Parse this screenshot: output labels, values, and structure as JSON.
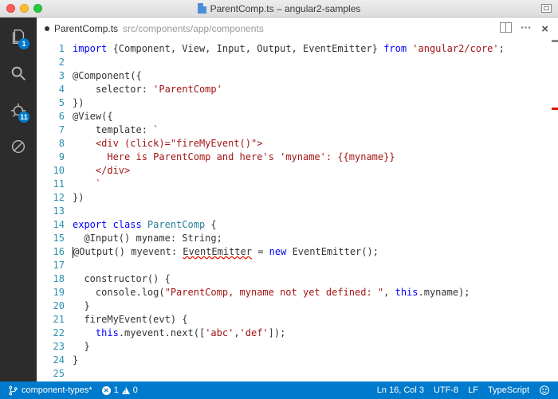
{
  "window": {
    "title_file": "ParentComp.ts",
    "title_project": "angular2-samples"
  },
  "tab": {
    "filename": "ParentComp.ts",
    "path": "src/components/app/components",
    "dirty": true
  },
  "activity": {
    "explorer_badge": "1",
    "debug_badge": "11"
  },
  "code": {
    "lines": [
      [
        {
          "t": "import ",
          "c": "kw"
        },
        {
          "t": "{Component, View, Input, Output, EventEmitter} "
        },
        {
          "t": "from ",
          "c": "kw"
        },
        {
          "t": "'angular2/core'",
          "c": "str"
        },
        {
          "t": ";"
        }
      ],
      [],
      [
        {
          "t": "@Component({"
        }
      ],
      [
        {
          "t": "    selector: "
        },
        {
          "t": "'ParentComp'",
          "c": "str"
        }
      ],
      [
        {
          "t": "})"
        }
      ],
      [
        {
          "t": "@View({"
        }
      ],
      [
        {
          "t": "    template: "
        },
        {
          "t": "`",
          "c": "str"
        }
      ],
      [
        {
          "t": "    <div (click)=\"fireMyEvent()\">",
          "c": "str"
        }
      ],
      [
        {
          "t": "      Here is ParentComp and here's 'myname': {{myname}}",
          "c": "str"
        }
      ],
      [
        {
          "t": "    </div>",
          "c": "str"
        }
      ],
      [
        {
          "t": "    `",
          "c": "str"
        }
      ],
      [
        {
          "t": "})"
        }
      ],
      [],
      [
        {
          "t": "export class ",
          "c": "kw"
        },
        {
          "t": "ParentComp ",
          "c": "cls"
        },
        {
          "t": "{"
        }
      ],
      [
        {
          "t": "  @Input() myname: String;"
        }
      ],
      [
        {
          "t": "  ",
          "caret": true
        },
        {
          "t": "@Output() myevent: "
        },
        {
          "t": "EventEmitter",
          "c": "err"
        },
        {
          "t": " = "
        },
        {
          "t": "new ",
          "c": "kw"
        },
        {
          "t": "EventEmitter();"
        }
      ],
      [],
      [
        {
          "t": "  constructor() {"
        }
      ],
      [
        {
          "t": "    console.log("
        },
        {
          "t": "\"ParentComp, myname not yet defined: \"",
          "c": "str"
        },
        {
          "t": ", "
        },
        {
          "t": "this",
          "c": "kw"
        },
        {
          "t": ".myname);"
        }
      ],
      [
        {
          "t": "  }"
        }
      ],
      [
        {
          "t": "  fireMyEvent(evt) {"
        }
      ],
      [
        {
          "t": "    "
        },
        {
          "t": "this",
          "c": "kw"
        },
        {
          "t": ".myevent.next(["
        },
        {
          "t": "'abc'",
          "c": "str"
        },
        {
          "t": ","
        },
        {
          "t": "'def'",
          "c": "str"
        },
        {
          "t": "]);"
        }
      ],
      [
        {
          "t": "  }"
        }
      ],
      [
        {
          "t": "}"
        }
      ],
      []
    ],
    "lineCount": 25
  },
  "status": {
    "branch": "component-types*",
    "errors": "1",
    "warnings": "0",
    "position": "Ln 16, Col 3",
    "encoding": "UTF-8",
    "eol": "LF",
    "language": "TypeScript"
  }
}
